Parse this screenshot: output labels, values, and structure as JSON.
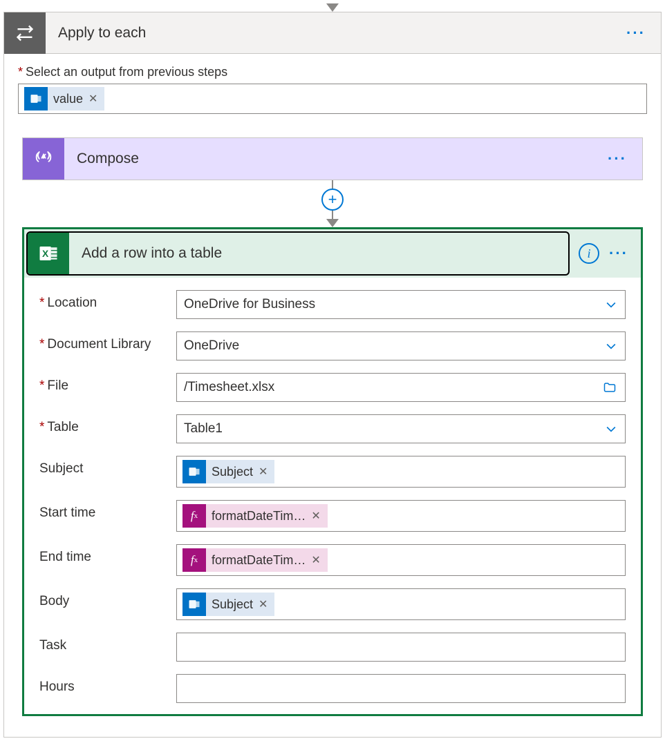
{
  "flow": {
    "apply_to_each": {
      "title": "Apply to each",
      "select_label": "Select an output from previous steps",
      "token": {
        "label": "value"
      }
    },
    "compose": {
      "title": "Compose"
    },
    "add_row": {
      "title": "Add a row into a table",
      "fields": {
        "location": {
          "label": "Location",
          "required": true,
          "value": "OneDrive for Business",
          "type": "dropdown"
        },
        "doc_library": {
          "label": "Document Library",
          "required": true,
          "value": "OneDrive",
          "type": "dropdown"
        },
        "file": {
          "label": "File",
          "required": true,
          "value": "/Timesheet.xlsx",
          "type": "file"
        },
        "table": {
          "label": "Table",
          "required": true,
          "value": "Table1",
          "type": "dropdown"
        },
        "subject": {
          "label": "Subject",
          "required": false,
          "token": {
            "kind": "outlook",
            "label": "Subject"
          }
        },
        "start_time": {
          "label": "Start time",
          "required": false,
          "token": {
            "kind": "fx",
            "label": "formatDateTim…"
          }
        },
        "end_time": {
          "label": "End time",
          "required": false,
          "token": {
            "kind": "fx",
            "label": "formatDateTim…"
          }
        },
        "body": {
          "label": "Body",
          "required": false,
          "token": {
            "kind": "outlook",
            "label": "Subject"
          }
        },
        "task": {
          "label": "Task",
          "required": false,
          "value": ""
        },
        "hours": {
          "label": "Hours",
          "required": false,
          "value": ""
        }
      }
    }
  },
  "glyphs": {
    "close": "✕",
    "required": "*",
    "plus": "+",
    "info": "i"
  }
}
